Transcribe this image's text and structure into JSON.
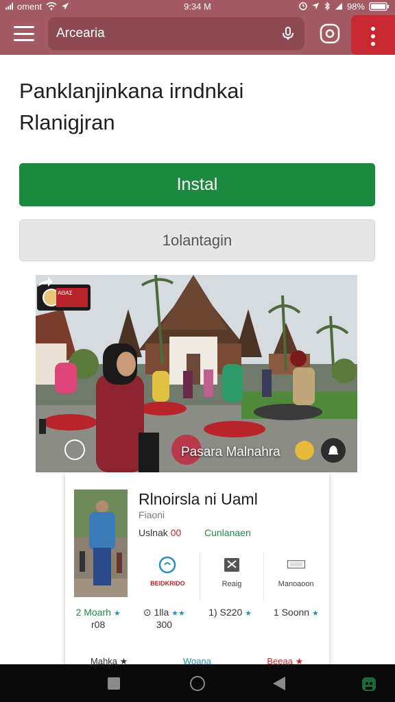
{
  "status_bar": {
    "carrier": "oment",
    "time": "9:34 M",
    "battery": "98%"
  },
  "app_bar": {
    "search": {
      "value": "Arcearia",
      "placeholder": ""
    },
    "icons": [
      "menu-icon",
      "mic-icon",
      "lens-icon",
      "more-vert-icon"
    ],
    "color": "#a35a63",
    "more_color": "#c8282f"
  },
  "page": {
    "title_line1": "Panklanjinkana irndnkai",
    "title_line2": "Rlanigjran"
  },
  "buttons": {
    "install": "Instal",
    "secondary": "1olantagin",
    "install_color": "#1b8a3e"
  },
  "hero": {
    "badge_text": "ΑΘΑΣ",
    "caption": "Pasara Malnahra"
  },
  "card": {
    "title": "Rlnoirsla ni Uaml",
    "subtitle": "Fiaoni",
    "meta_label": "Uslnak",
    "meta_accent": "00",
    "meta_right": "Cunlanaen",
    "stats": [
      {
        "icon": "clock-icon",
        "label": "BEIDKRIDO"
      },
      {
        "icon": "tools-icon",
        "label": "Reaig"
      },
      {
        "icon": "screen-icon",
        "label": "Manoaoon"
      }
    ],
    "ratings": [
      {
        "value": "2 Moarh",
        "stars": "★",
        "sub": "r08"
      },
      {
        "value": "⊙ 1lla",
        "stars": "★★",
        "sub": "300"
      },
      {
        "value": "1) S220",
        "stars": "★",
        "sub": ""
      },
      {
        "value": "1 Soonn",
        "stars": "★",
        "sub": ""
      }
    ],
    "bottom_row": [
      "Mahka ★",
      "Woana",
      "Beeaa ★"
    ]
  },
  "nav_bar": {
    "icons": [
      "recents-icon",
      "home-icon",
      "back-icon",
      "assistant-icon"
    ]
  }
}
